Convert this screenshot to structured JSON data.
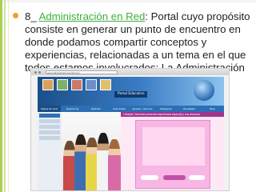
{
  "slide": {
    "paragraph_prefix": "8_ ",
    "link_text": "Administración en Red",
    "paragraph_body": ": Portal cuyo propósito consiste en generar un punto de encuentro en donde podamos compartir conceptos y experiencias, relacionadas a un tema en el que todos estamos involucrados: La Administración"
  },
  "screenshot": {
    "url": "www.administracionenred.com",
    "site_logo": "Portal Educativo",
    "nav_items": [
      "Página de inicio",
      "Quiénes Sx",
      "Editorial",
      "Aula Virtual",
      "Apuntes - Alumnos",
      "Categorías",
      "Novedades",
      "Blog"
    ],
    "headline": "Lifestyle Harrenbe presenta experiencia especial y sus alumnos"
  },
  "colors": {
    "bullet": "#f29e27",
    "link": "#3fae3f",
    "accent_bar": "#a9cf52",
    "site_nav": "#2d6fb5",
    "site_pink": "#f7b6e3"
  }
}
